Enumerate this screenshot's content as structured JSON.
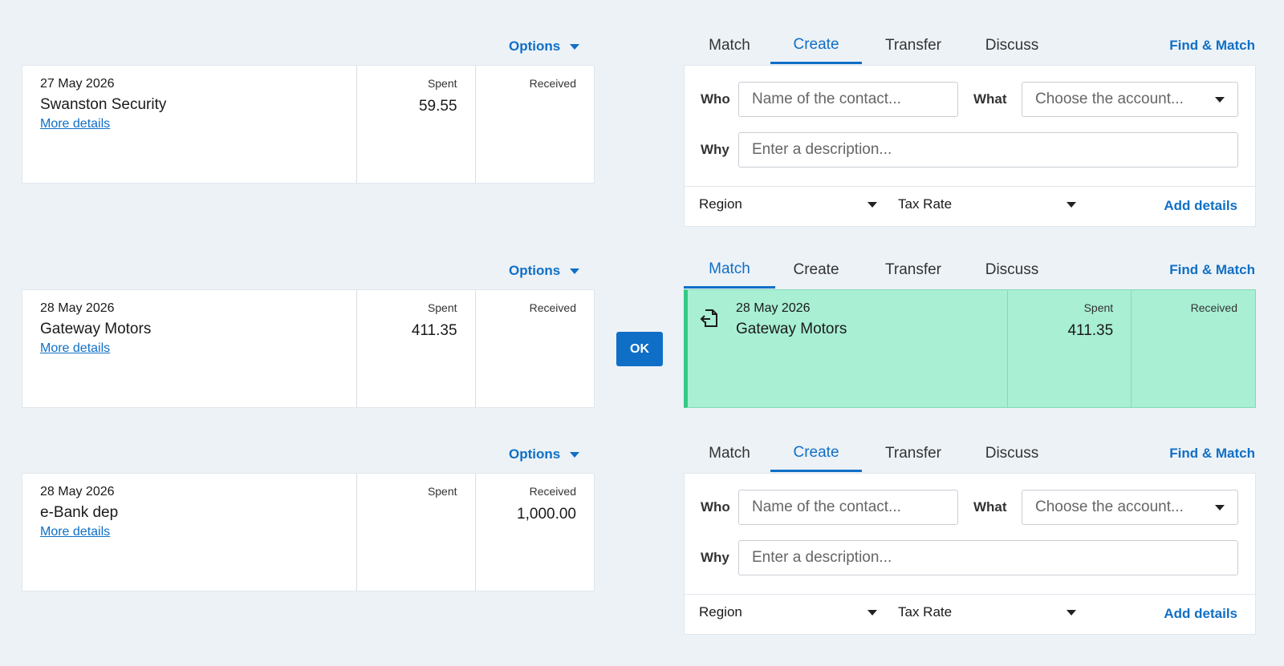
{
  "rows": [
    {
      "options_label": "Options",
      "statement": {
        "date": "27 May 2026",
        "payee": "Swanston Security",
        "more_details": "More details",
        "spent_label": "Spent",
        "received_label": "Received",
        "spent": "59.55",
        "received": ""
      },
      "tabs": [
        "Match",
        "Create",
        "Transfer",
        "Discuss"
      ],
      "active_tab": "Create",
      "find_match": "Find & Match",
      "create": {
        "who_label": "Who",
        "who_placeholder": "Name of the contact...",
        "what_label": "What",
        "what_placeholder": "Choose the account...",
        "why_label": "Why",
        "why_placeholder": "Enter a description...",
        "region": "Region",
        "tax_rate": "Tax Rate",
        "add_details": "Add details"
      }
    },
    {
      "options_label": "Options",
      "statement": {
        "date": "28 May 2026",
        "payee": "Gateway Motors",
        "more_details": "More details",
        "spent_label": "Spent",
        "received_label": "Received",
        "spent": "411.35",
        "received": ""
      },
      "ok_label": "OK",
      "tabs": [
        "Match",
        "Create",
        "Transfer",
        "Discuss"
      ],
      "active_tab": "Match",
      "find_match": "Find & Match",
      "match": {
        "date": "28 May 2026",
        "payee": "Gateway Motors",
        "spent_label": "Spent",
        "received_label": "Received",
        "spent": "411.35",
        "received": ""
      }
    },
    {
      "options_label": "Options",
      "statement": {
        "date": "28 May 2026",
        "payee": "e-Bank dep",
        "more_details": "More details",
        "spent_label": "Spent",
        "received_label": "Received",
        "spent": "",
        "received": "1,000.00"
      },
      "tabs": [
        "Match",
        "Create",
        "Transfer",
        "Discuss"
      ],
      "active_tab": "Create",
      "find_match": "Find & Match",
      "create": {
        "who_label": "Who",
        "who_placeholder": "Name of the contact...",
        "what_label": "What",
        "what_placeholder": "Choose the account...",
        "why_label": "Why",
        "why_placeholder": "Enter a description...",
        "region": "Region",
        "tax_rate": "Tax Rate",
        "add_details": "Add details"
      }
    }
  ],
  "icons": {
    "match_icon": "document-arrow-icon",
    "dropdown": "caret-down-icon"
  },
  "colors": {
    "accent": "#0f6fc6",
    "match_bg": "#a8efd4",
    "match_border": "#34c986",
    "page_bg": "#edf2f7"
  }
}
